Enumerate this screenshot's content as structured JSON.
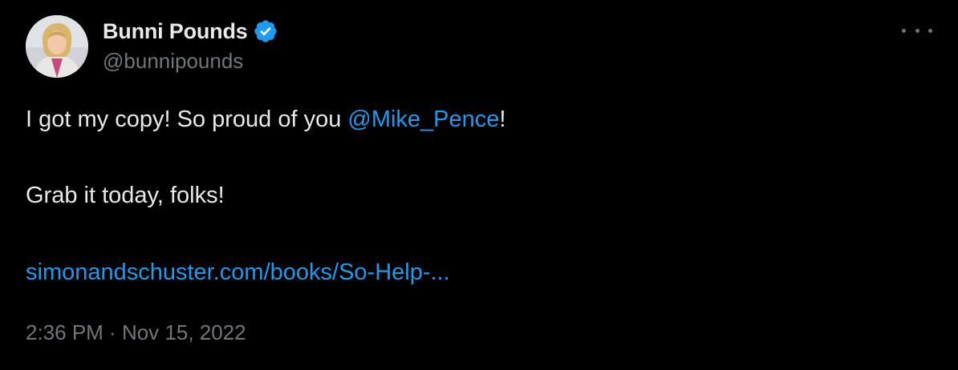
{
  "author": {
    "display_name": "Bunni Pounds",
    "handle": "@bunnipounds",
    "verified": true,
    "avatar_icon": "profile-photo"
  },
  "tweet": {
    "line1_prefix": "I got my copy! So proud of you ",
    "line1_mention": "@Mike_Pence",
    "line1_suffix": "!",
    "line2": "Grab it today, folks!",
    "link_text": "simonandschuster.com/books/So-Help-...",
    "time": "2:36 PM",
    "separator": " · ",
    "date": "Nov 15, 2022"
  },
  "menu": {
    "icon": "more-horizontal-icon"
  },
  "colors": {
    "background": "#000000",
    "text": "#e7e9ea",
    "secondary": "#71767b",
    "accent": "#1d9bf0"
  }
}
